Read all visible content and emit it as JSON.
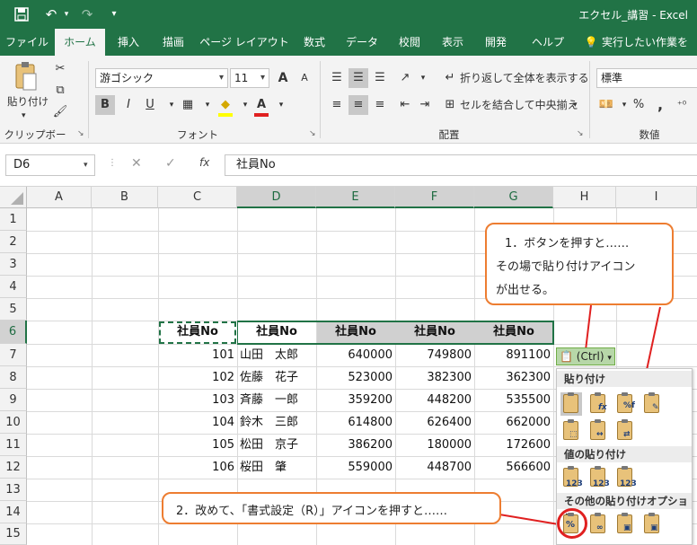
{
  "window": {
    "title": "エクセル_講習  -  Excel"
  },
  "qat": {
    "save": "save-icon",
    "undo": "undo-icon",
    "redo": "redo-icon",
    "customize": "customize-icon"
  },
  "tabs": [
    "ファイル",
    "ホーム",
    "挿入",
    "描画",
    "ページ レイアウト",
    "数式",
    "データ",
    "校閲",
    "表示",
    "開発",
    "ヘルプ",
    "実行したい作業を入"
  ],
  "active_tab": "ホーム",
  "ribbon": {
    "clipboard": {
      "paste_label": "貼り付け",
      "group_label": "クリップボード"
    },
    "font": {
      "font_name": "游ゴシック",
      "font_size": "11",
      "bold": "B",
      "italic": "I",
      "underline": "U",
      "grow": "A",
      "shrink": "A",
      "font_color": "A",
      "group_label": "フォント"
    },
    "alignment": {
      "wrap_text": "折り返して全体を表示する",
      "merge_center": "セルを結合して中央揃え",
      "group_label": "配置"
    },
    "number": {
      "format": "標準",
      "percent": "%",
      "comma": ",",
      "group_label": "数値"
    }
  },
  "formula_bar": {
    "name_box": "D6",
    "cancel": "✕",
    "enter": "✓",
    "fx": "fx",
    "content": "社員No"
  },
  "grid": {
    "columns": [
      "A",
      "B",
      "C",
      "D",
      "E",
      "F",
      "G",
      "H",
      "I"
    ],
    "rows": [
      "1",
      "2",
      "3",
      "4",
      "5",
      "6",
      "7",
      "8",
      "9",
      "10",
      "11",
      "12",
      "13",
      "14",
      "15"
    ],
    "header_row": {
      "c": "社員No",
      "d": "社員No",
      "e": "社員No",
      "f": "社員No",
      "g": "社員No"
    },
    "data": [
      {
        "c": "101",
        "d": "山田　太郎",
        "e": "640000",
        "f": "749800",
        "g": "891100"
      },
      {
        "c": "102",
        "d": "佐藤　花子",
        "e": "523000",
        "f": "382300",
        "g": "362300"
      },
      {
        "c": "103",
        "d": "斉藤　一郎",
        "e": "359200",
        "f": "448200",
        "g": "535500"
      },
      {
        "c": "104",
        "d": "鈴木　三郎",
        "e": "614800",
        "f": "626400",
        "g": "662000"
      },
      {
        "c": "105",
        "d": "松田　京子",
        "e": "386200",
        "f": "180000",
        "g": "172600"
      },
      {
        "c": "106",
        "d": "桜田　肇",
        "e": "559000",
        "f": "448700",
        "g": "566600"
      }
    ]
  },
  "callouts": {
    "one": {
      "line1": "1．ボタンを押すと……",
      "line2": "その場で貼り付けアイコン",
      "line3": "が出せる。"
    },
    "two": {
      "text": "2．改めて、「書式設定（R）」アイコンを押すと……"
    }
  },
  "paste_options": {
    "ctrl_label": "(Ctrl)",
    "sections": [
      "貼り付け",
      "値の貼り付け",
      "その他の貼り付けオプション"
    ]
  },
  "colors": {
    "accent": "#217346",
    "callout_border": "#ed7d31",
    "highlight_circle": "#e02020"
  }
}
